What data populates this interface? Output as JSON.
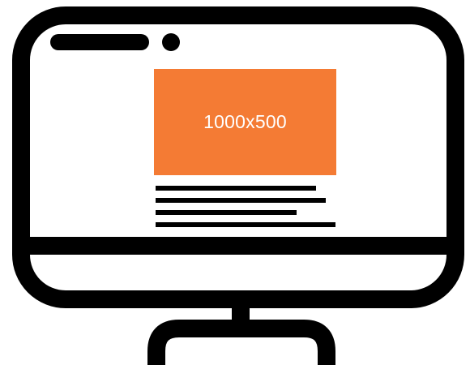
{
  "placeholder": {
    "label": "1000x500",
    "color": "#F47B34"
  },
  "colors": {
    "outline": "#000000",
    "background": "#FFFFFF"
  },
  "icons": [
    "desktop-monitor-icon"
  ]
}
